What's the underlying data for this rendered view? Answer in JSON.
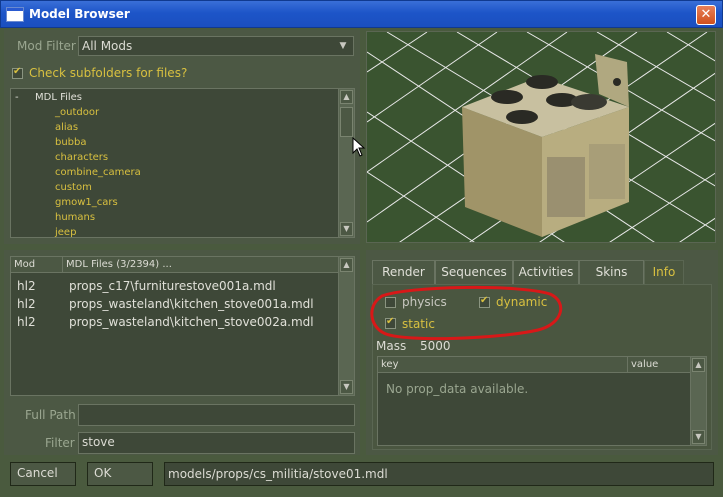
{
  "window": {
    "title": "Model Browser"
  },
  "mod_filter": {
    "label": "Mod Filter",
    "value": "All Mods"
  },
  "subfolders": {
    "label": "Check subfolders for files?",
    "checked": true
  },
  "tree": {
    "root": "MDL Files",
    "root_toggle": "-",
    "items": [
      "_outdoor",
      "alias",
      "bubba",
      "characters",
      "combine_camera",
      "custom",
      "gmow1_cars",
      "humans",
      "jeep"
    ]
  },
  "files": {
    "col_mod": "Mod",
    "col_files": "MDL Files (3/2394) ...",
    "rows": [
      {
        "mod": "hl2",
        "path": "props_c17\\furniturestove001a.mdl"
      },
      {
        "mod": "hl2",
        "path": "props_wasteland\\kitchen_stove001a.mdl"
      },
      {
        "mod": "hl2",
        "path": "props_wasteland\\kitchen_stove002a.mdl"
      }
    ]
  },
  "full_path": {
    "label": "Full Path",
    "value": ""
  },
  "filter": {
    "label": "Filter",
    "value": "stove"
  },
  "tabs": [
    "Render",
    "Sequences",
    "Activities",
    "Skins",
    "Info"
  ],
  "info": {
    "physics": {
      "label": "physics",
      "checked": false
    },
    "dynamic": {
      "label": "dynamic",
      "checked": true
    },
    "static": {
      "label": "static",
      "checked": true
    },
    "mass_label": "Mass",
    "mass_value": "5000",
    "col_key": "key",
    "col_value": "value",
    "empty_message": "No prop_data available."
  },
  "footer": {
    "cancel_label": "Cancel",
    "ok_label": "OK",
    "model_path": "models/props/cs_militia/stove01.mdl"
  },
  "colors": {
    "accent_yellow": "#d8c040",
    "panel": "#4c5844",
    "annotation_red": "#d81818"
  }
}
